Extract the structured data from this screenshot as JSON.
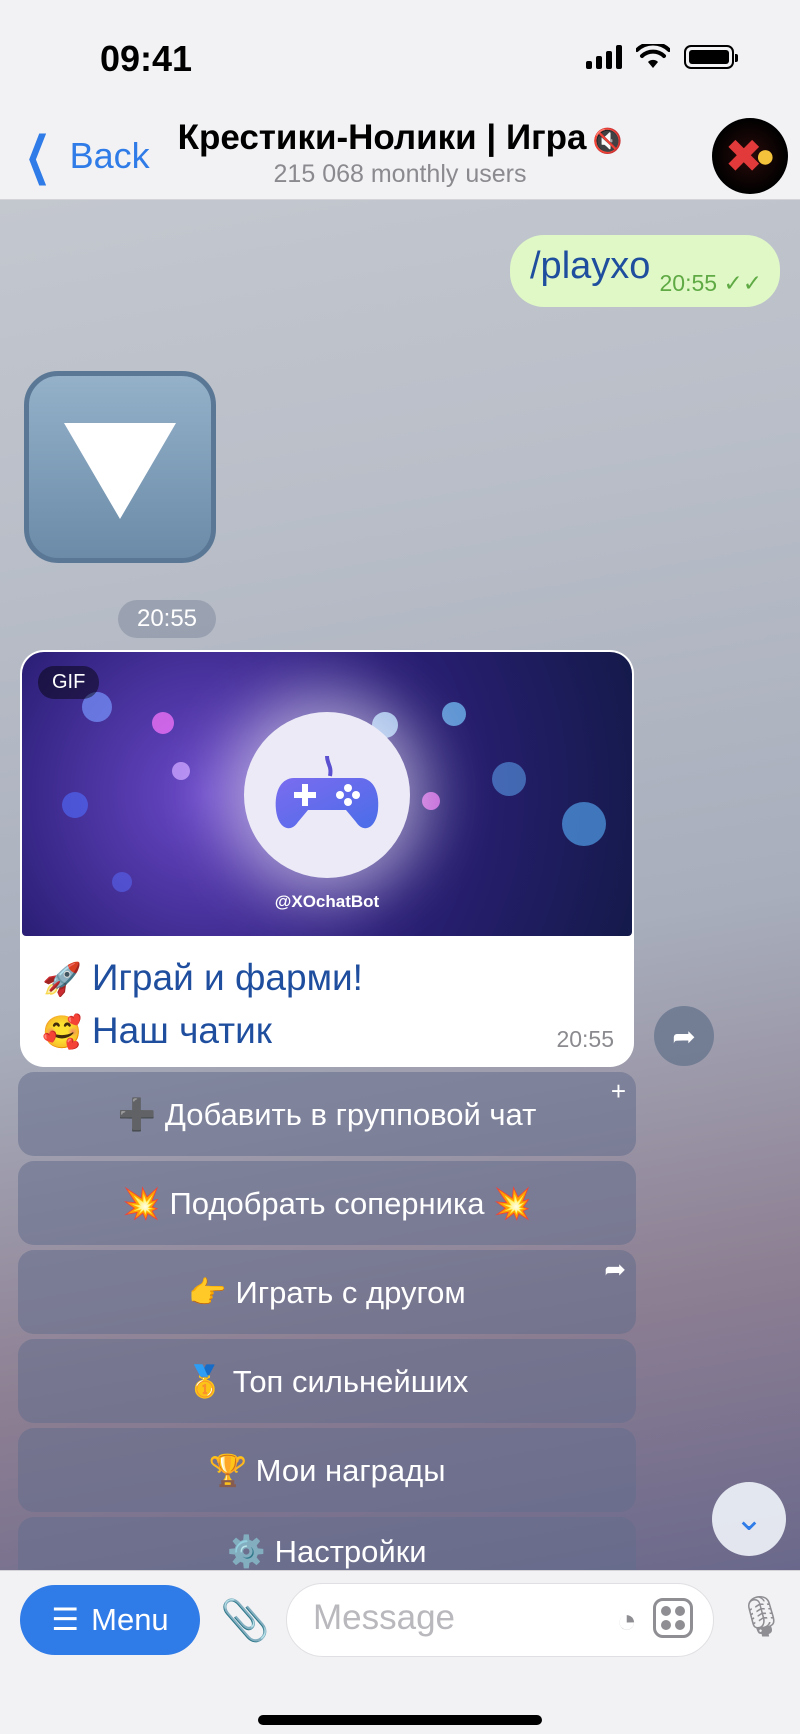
{
  "status": {
    "time": "09:41"
  },
  "header": {
    "back_label": "Back",
    "title": "Крестики-Нолики | Игра",
    "subtitle": "215 068 monthly users"
  },
  "outgoing": {
    "text": "/playxo",
    "time": "20:55"
  },
  "dice_time": "20:55",
  "card": {
    "gif_label": "GIF",
    "gif_handle": "@XOchatBot",
    "lines": [
      {
        "emoji": "🚀",
        "text": "Играй и фарми!"
      },
      {
        "emoji": "🥰",
        "text": "Наш чатик"
      }
    ],
    "time": "20:55"
  },
  "keyboard": {
    "buttons": [
      {
        "label": "➕ Добавить в групповой чат",
        "corner": "+"
      },
      {
        "label": "💥 Подобрать соперника 💥",
        "corner": ""
      },
      {
        "label": "👉 Играть с другом",
        "corner": "➦"
      },
      {
        "label": "🥇 Топ сильнейших",
        "corner": ""
      },
      {
        "label": "🏆 Мои награды",
        "corner": ""
      },
      {
        "label": "⚙️ Настройки",
        "corner": ""
      }
    ]
  },
  "composer": {
    "menu_label": "Menu",
    "placeholder": "Message"
  },
  "colors": {
    "accent": "#2f7be7",
    "outgoing_bubble": "#dff8c6",
    "link_text": "#1f4e9e"
  }
}
